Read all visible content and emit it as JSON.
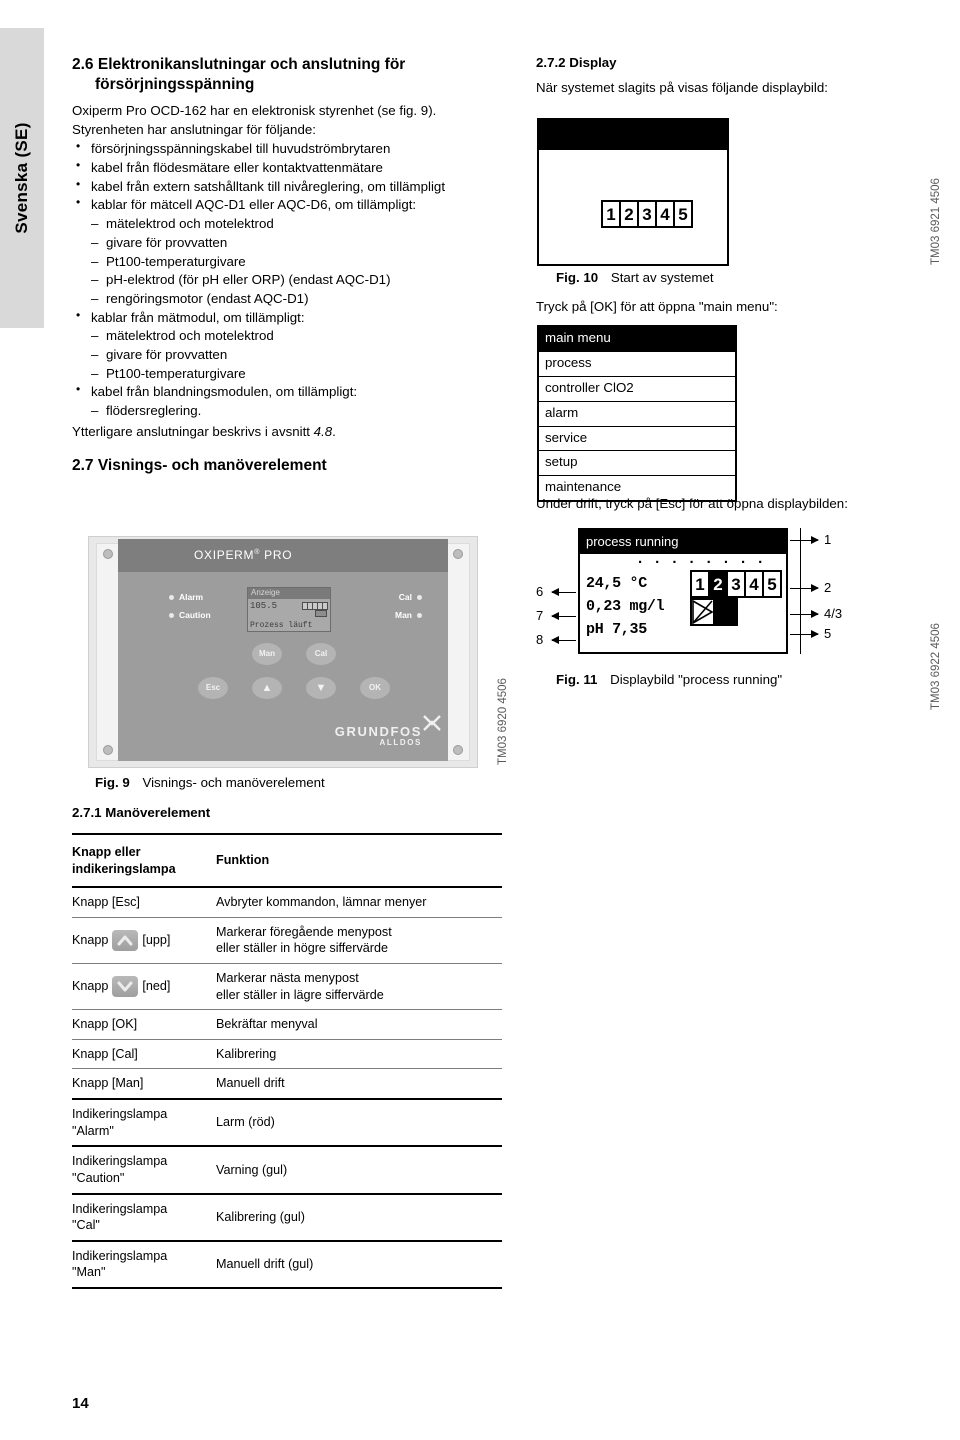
{
  "language_tab": "Svenska (SE)",
  "page_number": "14",
  "left_column": {
    "section_26": {
      "number": "2.6",
      "title_line1": "Elektronikanslutningar och anslutning för",
      "title_line2": "försörjningsspänning",
      "intro_line1": "Oxiperm Pro OCD-162 har en elektronisk styrenhet (se fig. 9).",
      "intro_line2": "Styrenheten har anslutningar för följande:",
      "bullets": [
        "försörjningsspänningskabel till huvudströmbrytaren",
        "kabel från flödesmätare eller kontaktvattenmätare",
        "kabel från extern satshålltank till nivåreglering, om tillämpligt",
        "kablar för mätcell AQC-D1 eller AQC-D6, om tillämpligt:"
      ],
      "sub1": [
        "mätelektrod och motelektrod",
        "givare för provvatten",
        "Pt100-temperaturgivare",
        "pH-elektrod (för pH eller ORP) (endast AQC-D1)",
        "rengöringsmotor (endast AQC-D1)"
      ],
      "bullet2": "kablar från mätmodul, om tillämpligt:",
      "sub2": [
        "mätelektrod och motelektrod",
        "givare för provvatten",
        "Pt100-temperaturgivare"
      ],
      "bullet3": "kabel från blandningsmodulen, om tillämpligt:",
      "sub3": [
        "flödersreglering."
      ],
      "closing_prefix": "Ytterligare anslutningar beskrivs i avsnitt ",
      "closing_ref": "4.8",
      "closing_suffix": "."
    },
    "section_27": {
      "number": "2.7",
      "title": "Visnings- och manöverelement"
    },
    "fig9": {
      "label": "Fig. 9",
      "caption": "Visnings- och manöverelement",
      "tm_code": "TM03 6920 4506",
      "device": {
        "brand": "OXIPERM",
        "brand_sup": "®",
        "brand_suffix": "PRO",
        "lamps_left": [
          "Alarm",
          "Caution"
        ],
        "lamps_right": [
          "Cal",
          "Man"
        ],
        "lcd_title": "Anzeige",
        "lcd_value": "105.5",
        "lcd_status": "Prozess läuft",
        "buttons": [
          "Man",
          "Cal",
          "Esc",
          "up",
          "down",
          "OK"
        ],
        "logo": "GRUNDFOS",
        "logo_sub": "ALLDOS"
      }
    },
    "section_271": {
      "number": "2.7.1",
      "title": "Manöverelement"
    },
    "table": {
      "header": {
        "col1_line1": "Knapp eller",
        "col1_line2": "indikeringslampa",
        "col2": "Funktion"
      },
      "rows": [
        {
          "key": "Knapp [Esc]",
          "fn_line1": "Avbryter kommandon, lämnar menyer",
          "fn_line2": "",
          "icon": ""
        },
        {
          "key_prefix": "Knapp",
          "key_suffix": "[upp]",
          "icon": "chevron-up",
          "fn_line1": "Markerar föregående menypost",
          "fn_line2": "eller ställer in högre siffervärde"
        },
        {
          "key_prefix": "Knapp",
          "key_suffix": "[ned]",
          "icon": "chevron-down",
          "fn_line1": "Markerar nästa menypost",
          "fn_line2": "eller ställer in lägre siffervärde"
        },
        {
          "key": "Knapp [OK]",
          "fn_line1": "Bekräftar menyval",
          "fn_line2": "",
          "icon": ""
        },
        {
          "key": "Knapp [Cal]",
          "fn_line1": "Kalibrering",
          "fn_line2": "",
          "icon": ""
        },
        {
          "key": "Knapp [Man]",
          "fn_line1": "Manuell drift",
          "fn_line2": "",
          "icon": ""
        },
        {
          "key_line1": "Indikeringslampa",
          "key_line2": "\"Alarm\"",
          "fn_line1": "Larm (röd)",
          "fn_line2": "",
          "icon": ""
        },
        {
          "key_line1": "Indikeringslampa",
          "key_line2": "\"Caution\"",
          "fn_line1": "Varning (gul)",
          "fn_line2": "",
          "icon": ""
        },
        {
          "key_line1": "Indikeringslampa",
          "key_line2": "\"Cal\"",
          "fn_line1": "Kalibrering (gul)",
          "fn_line2": "",
          "icon": ""
        },
        {
          "key_line1": "Indikeringslampa",
          "key_line2": "\"Man\"",
          "fn_line1": "Manuell drift (gul)",
          "fn_line2": "",
          "icon": ""
        }
      ]
    }
  },
  "right_column": {
    "section_272": {
      "number": "2.7.2",
      "title": "Display"
    },
    "intro": "När systemet slagits på visas följande displaybild:",
    "fig10": {
      "label": "Fig. 10",
      "caption": "Start av systemet",
      "tm_code": "TM03 6921 4506",
      "digits": [
        "1",
        "2",
        "3",
        "4",
        "5"
      ]
    },
    "menu_intro": "Tryck på [OK] för att öppna \"main menu\":",
    "menu": {
      "selected": "main menu",
      "items": [
        "main menu",
        "process",
        "controller ClO2",
        "alarm",
        "service",
        "setup",
        "maintenance"
      ]
    },
    "esc_intro": "Under drift, tryck på [Esc] för att öppna displaybilden:",
    "fig11": {
      "label": "Fig. 11",
      "caption": "Displaybild \"process running\"",
      "tm_code": "TM03 6922 4506",
      "header": "process running",
      "dots": "· · · · · · · ·",
      "row_temp": "24,5 °C",
      "row_conc": "0,23 mg/l",
      "row_ph": "pH 7,35",
      "digits": [
        "1",
        "2",
        "3",
        "4",
        "5"
      ],
      "digit_selected": "2",
      "callouts_right": [
        "1",
        "2",
        "4/3",
        "5"
      ],
      "callouts_left": [
        "6",
        "7",
        "8"
      ]
    }
  }
}
